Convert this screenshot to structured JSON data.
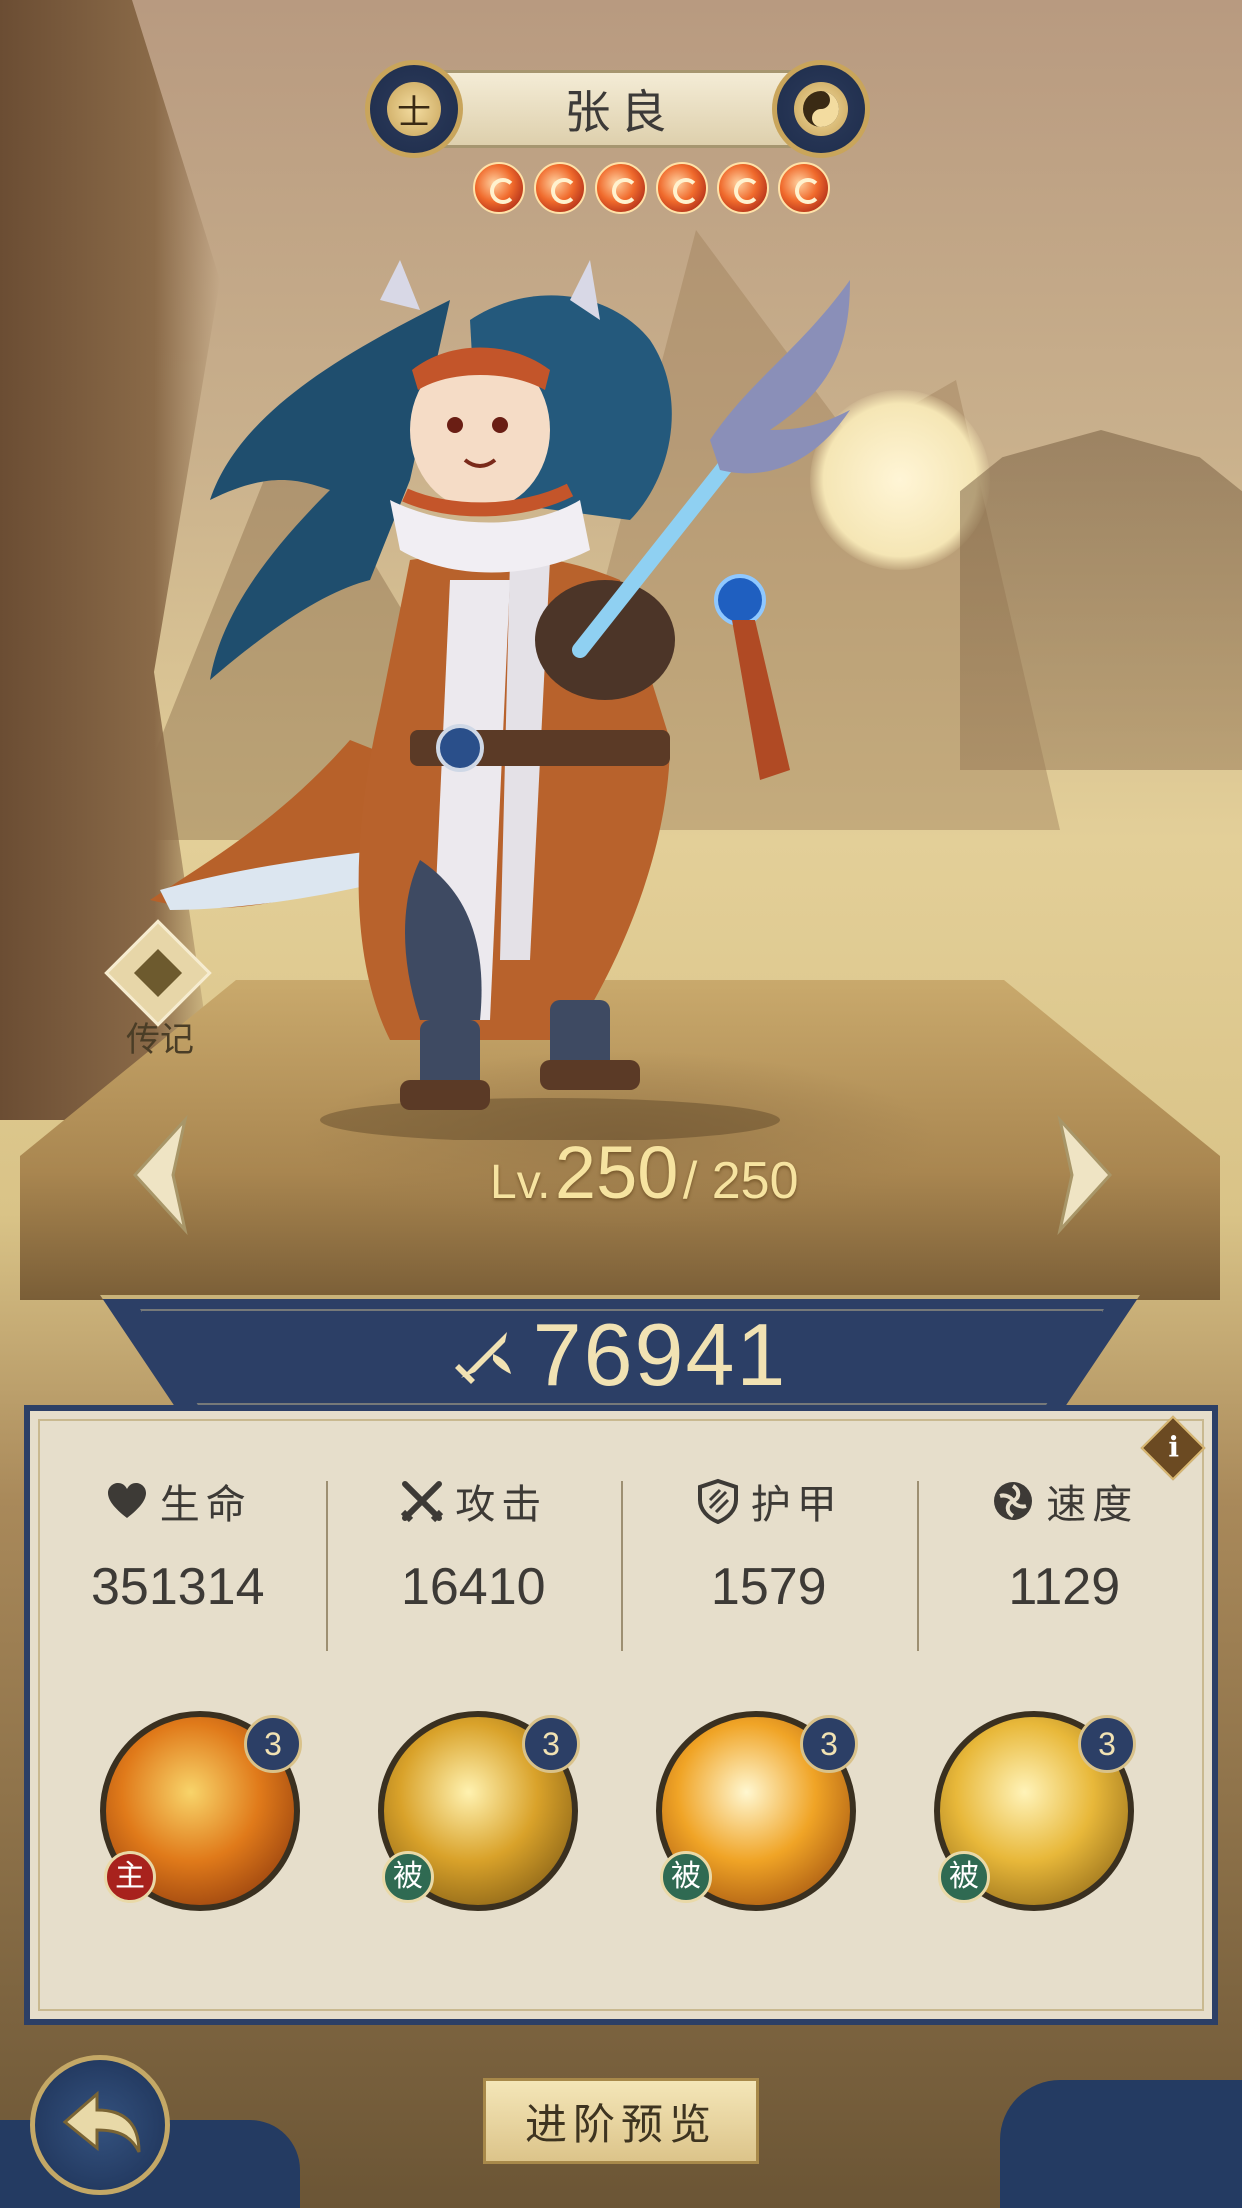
{
  "header": {
    "hero_name": "张良",
    "faction_badge_glyph": "士",
    "element_badge": "yin-yang-icon",
    "star_count": 6
  },
  "hero": {
    "level_prefix": "Lv.",
    "level_current": "250",
    "level_max": "/ 250",
    "legend_label": "传记"
  },
  "power": {
    "value": "76941",
    "icon": "sword-power-icon"
  },
  "stats": [
    {
      "label": "生命",
      "value": "351314",
      "icon": "heart-icon"
    },
    {
      "label": "攻击",
      "value": "16410",
      "icon": "crossed-swords-icon"
    },
    {
      "label": "护甲",
      "value": "1579",
      "icon": "shield-icon"
    },
    {
      "label": "速度",
      "value": "1129",
      "icon": "swirl-speed-icon"
    }
  ],
  "skills": [
    {
      "level": "3",
      "tag": "主",
      "type": "active",
      "colors": [
        "#f8d46a",
        "#e07a1a",
        "#7a2a0a"
      ]
    },
    {
      "level": "3",
      "tag": "被",
      "type": "passive",
      "colors": [
        "#fff2b0",
        "#d9a22a",
        "#6a4a10"
      ]
    },
    {
      "level": "3",
      "tag": "被",
      "type": "passive",
      "colors": [
        "#fff7d0",
        "#f0a426",
        "#8a3a0a"
      ]
    },
    {
      "level": "3",
      "tag": "被",
      "type": "passive",
      "colors": [
        "#fff3b8",
        "#e8b83a",
        "#7a5510"
      ]
    }
  ],
  "footer": {
    "advance_preview_label": "进阶预览"
  },
  "info_glyph": "i"
}
